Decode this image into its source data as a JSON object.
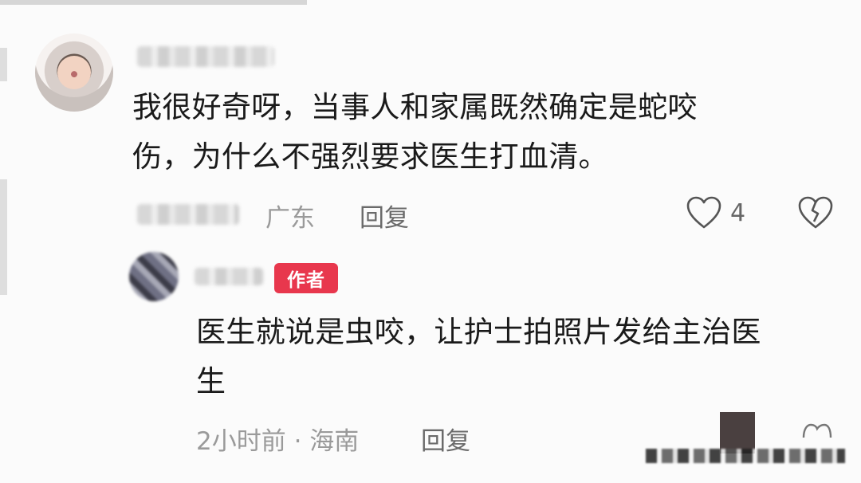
{
  "comment": {
    "text_line1": "我很好奇呀，当事人和家属既然确定是蛇咬",
    "text_line2": "伤，为什么不强烈要求医生打血清。",
    "location": "广东",
    "reply_label": "回复",
    "like_count": "4",
    "icons": {
      "like": "heart-outline-icon",
      "dislike": "broken-heart-icon"
    }
  },
  "reply": {
    "author_badge": "作者",
    "text_line1": "医生就说是虫咬，让护士拍照片发给主治医",
    "text_line2": "生",
    "meta": "2小时前 · 海南",
    "reply_label": "回复"
  },
  "colors": {
    "badge": "#e8374d",
    "muted_text": "#9a9a9a",
    "body_text": "#1a1a1a"
  }
}
